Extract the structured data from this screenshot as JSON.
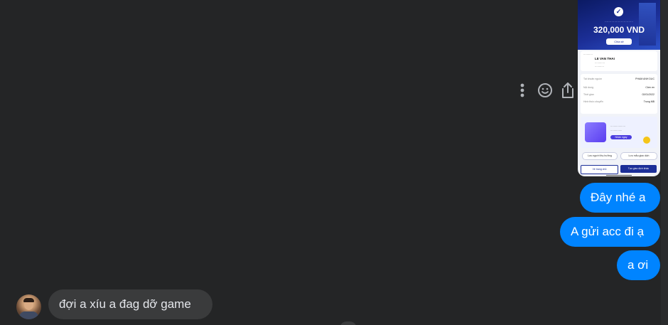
{
  "receipt_image": {
    "amount": "320,000 VND",
    "share_label": "Chia sẻ",
    "recipient_name": "LE VAN THAI",
    "details": [
      {
        "label": "Tài khoản nguồn",
        "value": "PHAM ANH DUC"
      },
      {
        "label": "Nội dung",
        "value": "Cảm ơn"
      },
      {
        "label": "Thời gian",
        "value": "02/01/2022"
      },
      {
        "label": "Hình thức chuyển",
        "value": "Trong MB"
      }
    ],
    "promo_button": "Nhận ngay",
    "pill_left": "Lưu người thụ hưởng",
    "pill_right": "Lưu mẫu giao dịch",
    "btn_home": "Về trang chủ",
    "btn_new": "Tạo giao dịch khác"
  },
  "messages": [
    {
      "side": "sent",
      "text": "Đây nhé a"
    },
    {
      "side": "sent",
      "text": "A gửi acc đi ạ"
    },
    {
      "side": "sent",
      "text": "a ơi"
    },
    {
      "side": "received",
      "text": "đợi a xíu a đag dỡ game"
    }
  ],
  "icons": {
    "more": "more-vertical-icon",
    "react": "smiley-icon",
    "forward": "share-icon"
  },
  "colors": {
    "background": "#242526",
    "sent_bubble": "#0084ff",
    "received_bubble": "#3a3b3c"
  }
}
